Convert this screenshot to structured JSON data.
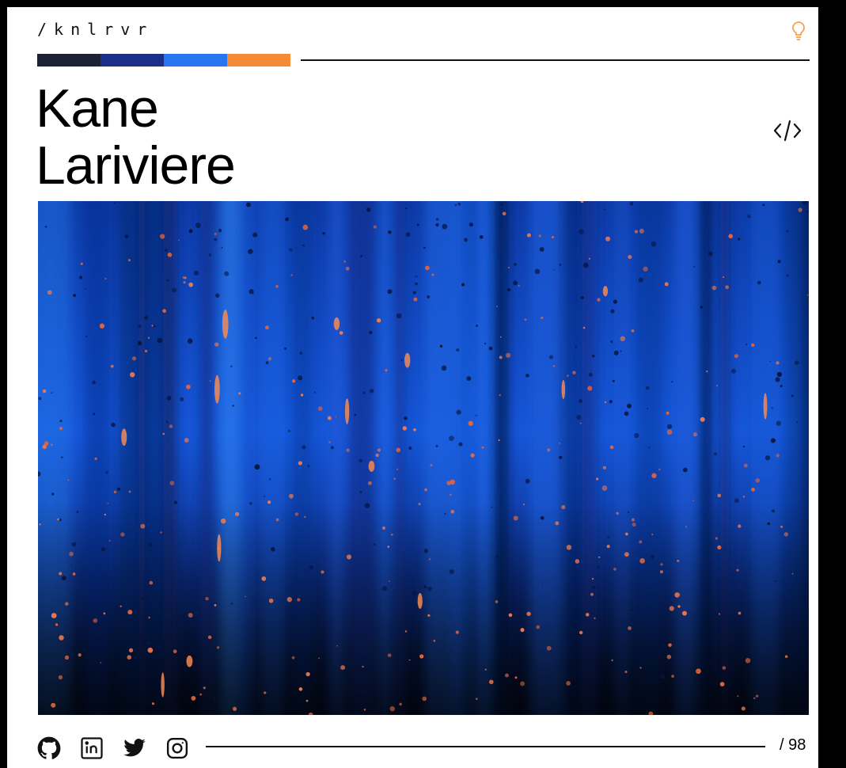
{
  "header": {
    "logo_text": "/knlrvr",
    "theme_icon": "lightbulb-icon",
    "palette": [
      "#1b2234",
      "#1a2f85",
      "#2a74f0",
      "#f78a34"
    ]
  },
  "hero": {
    "name_line1": "Kane",
    "name_line2": "Lariviere",
    "code_icon": "code-icon"
  },
  "image": {
    "description_colors": {
      "blue": "#1753d1",
      "deep_blue": "#0a1f63",
      "orange": "#f2784b"
    }
  },
  "footer": {
    "social": [
      {
        "name": "github",
        "icon": "github-icon"
      },
      {
        "name": "linkedin",
        "icon": "linkedin-icon"
      },
      {
        "name": "twitter",
        "icon": "twitter-icon"
      },
      {
        "name": "instagram",
        "icon": "instagram-icon"
      }
    ],
    "page_count": "/ 98"
  },
  "colors": {
    "accent_orange": "#f5a34e",
    "frame": "#000000"
  }
}
